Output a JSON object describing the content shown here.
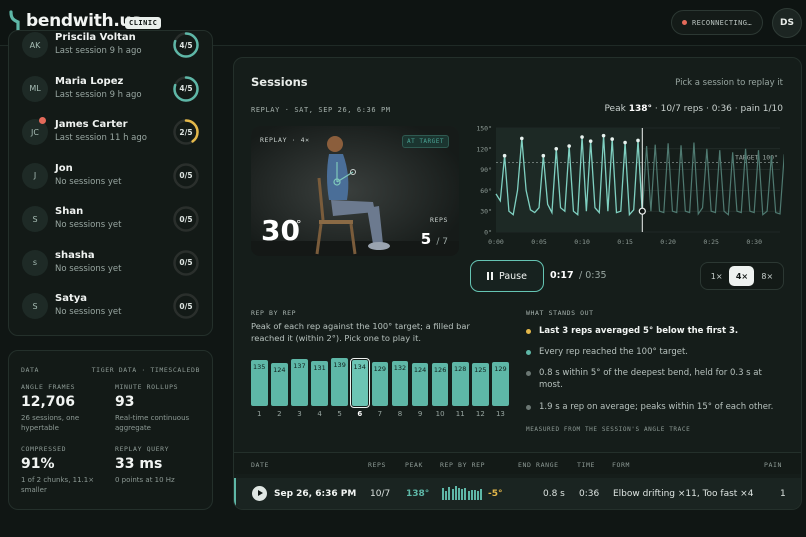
{
  "app": {
    "brand": "bendwith.us",
    "badge": "CLINIC",
    "status": "RECONNECTING…",
    "user_initials": "DS"
  },
  "colors": {
    "accent": "#5eb7a7",
    "warning": "#e4b84a",
    "alert": "#e46a5a",
    "background": "#101614"
  },
  "patients": [
    {
      "initials": "AK",
      "name": "Priscila Voltan",
      "sub": "Last session 9 h ago",
      "score": "4/5",
      "progress": 0.8,
      "color": "#5eb7a7",
      "alert": false
    },
    {
      "initials": "ML",
      "name": "Maria Lopez",
      "sub": "Last session 9 h ago",
      "score": "4/5",
      "progress": 0.8,
      "color": "#5eb7a7",
      "alert": false
    },
    {
      "initials": "JC",
      "name": "James Carter",
      "sub": "Last session 11 h ago",
      "score": "2/5",
      "progress": 0.4,
      "color": "#e4b84a",
      "alert": true
    },
    {
      "initials": "J",
      "name": "Jon",
      "sub": "No sessions yet",
      "score": "0/5",
      "progress": 0,
      "color": "#5eb7a7",
      "alert": false
    },
    {
      "initials": "S",
      "name": "Shan",
      "sub": "No sessions yet",
      "score": "0/5",
      "progress": 0,
      "color": "#5eb7a7",
      "alert": false
    },
    {
      "initials": "s",
      "name": "shasha",
      "sub": "No sessions yet",
      "score": "0/5",
      "progress": 0,
      "color": "#5eb7a7",
      "alert": false
    },
    {
      "initials": "S",
      "name": "Satya",
      "sub": "No sessions yet",
      "score": "0/5",
      "progress": 0,
      "color": "#5eb7a7",
      "alert": false
    }
  ],
  "data_panel": {
    "title": "DATA",
    "source": "TIGER DATA · TIMESCALEDB",
    "angle_frames_label": "ANGLE FRAMES",
    "angle_frames_value": "12,706",
    "angle_frames_sub": "26 sessions, one hypertable",
    "rollups_label": "MINUTE ROLLUPS",
    "rollups_value": "93",
    "rollups_sub": "Real-time continuous aggregate",
    "compressed_label": "COMPRESSED",
    "compressed_value": "91%",
    "compressed_sub": "1 of 2 chunks, 11.1× smaller",
    "query_label": "REPLAY QUERY",
    "query_value": "33 ms",
    "query_sub": "0 points at 10 Hz"
  },
  "sessions": {
    "title": "Sessions",
    "hint": "Pick a session to replay it",
    "replay_label": "REPLAY · SAT, SEP 26, 6:36 PM",
    "peak_prefix": "Peak",
    "peak_value": "138°",
    "peak_rest": "· 10/7 reps · 0:36 · pain 1/10",
    "video": {
      "label": "REPLAY · 4×",
      "badge": "AT TARGET",
      "angle": "30",
      "deg": "°",
      "reps_label": "REPS",
      "reps": "5",
      "reps_total": "/ 7"
    },
    "controls": {
      "pause": "Pause",
      "time_current": "0:17",
      "time_total": "/ 0:35",
      "speeds": [
        "1×",
        "4×",
        "8×"
      ],
      "speed_active": 1
    },
    "rep_by_rep": {
      "title": "REP BY REP",
      "desc": "Peak of each rep against the 100° target; a filled bar reached it (within 2°). Pick one to play it.",
      "selected": 5
    },
    "stands_out": {
      "title": "WHAT STANDS OUT",
      "items": [
        {
          "text": "Last 3 reps averaged 5° below the first 3.",
          "color": "#e4b84a",
          "highlight": true
        },
        {
          "text": "Every rep reached the 100° target.",
          "color": "#5eb7a7",
          "highlight": false
        },
        {
          "text": "0.8 s within 5° of the deepest bend, held for 0.3 s at most.",
          "color": "#6b7773",
          "highlight": false
        },
        {
          "text": "1.9 s a rep on average; peaks within 15° of each other.",
          "color": "#6b7773",
          "highlight": false
        }
      ],
      "footer": "MEASURED FROM THE SESSION'S ANGLE TRACE"
    },
    "table": {
      "headers": [
        "DATE",
        "REPS",
        "PEAK",
        "REP BY REP",
        "END RANGE",
        "TIME",
        "FORM",
        "PAIN"
      ],
      "row": {
        "date": "Sep 26, 6:36 PM",
        "reps": "10/7",
        "peak": "138°",
        "delta": "-5°",
        "end_range": "0.8 s",
        "time": "0:36",
        "form": "Elbow drifting ×11, Too fast ×4",
        "pain": "1"
      }
    }
  },
  "chart_data": {
    "type": "line",
    "xlabel": "",
    "ylabel": "",
    "xlim": [
      0,
      0.55
    ],
    "ylim": [
      0,
      150
    ],
    "x_ticks": [
      "0:00",
      "0:05",
      "0:10",
      "0:15",
      "0:20",
      "0:25",
      "0:30"
    ],
    "y_ticks": [
      "0°",
      "30°",
      "60°",
      "90°",
      "120°",
      "150°"
    ],
    "target": 100,
    "target_label": "TARGET 100°",
    "playhead_seconds": 17,
    "series": [
      {
        "x": [
          0,
          0.5,
          1,
          1.5,
          2,
          2.5,
          3,
          3.5,
          4,
          4.5,
          5,
          5.5,
          6,
          6.5,
          7,
          7.5,
          8,
          8.5,
          9,
          9.5,
          10,
          10.5,
          11,
          11.5,
          12,
          12.5,
          13,
          13.5,
          14,
          14.5,
          15,
          15.5,
          16,
          16.5,
          17,
          17.5,
          18,
          18.5,
          19,
          19.5,
          20,
          20.5,
          21,
          21.5,
          22,
          22.5,
          23,
          23.5,
          24,
          24.5,
          25,
          25.5,
          26,
          26.5,
          27,
          27.5,
          28,
          28.5,
          29,
          29.5,
          30,
          30.5,
          31,
          31.5,
          32,
          32.5,
          33,
          33.5,
          34,
          34.5,
          35
        ],
        "y": [
          55,
          45,
          110,
          30,
          25,
          60,
          135,
          60,
          32,
          28,
          35,
          110,
          40,
          28,
          120,
          35,
          30,
          124,
          30,
          25,
          137,
          30,
          131,
          35,
          28,
          139,
          30,
          134,
          28,
          30,
          129,
          25,
          32,
          132,
          28,
          124,
          30,
          126,
          30,
          28,
          128,
          30,
          28,
          125,
          30,
          28,
          129,
          26,
          35,
          120,
          30,
          28,
          118,
          30,
          25,
          115,
          30,
          28,
          120,
          30,
          28,
          118,
          25,
          30,
          110,
          28,
          26,
          112,
          30,
          28,
          25
        ]
      }
    ]
  },
  "reps_data": {
    "type": "bar",
    "categories": [
      "1",
      "2",
      "3",
      "4",
      "5",
      "6",
      "7",
      "8",
      "9",
      "10",
      "11",
      "12",
      "13"
    ],
    "values": [
      135,
      124,
      137,
      131,
      139,
      134,
      129,
      132,
      124,
      126,
      128,
      125,
      129
    ]
  }
}
